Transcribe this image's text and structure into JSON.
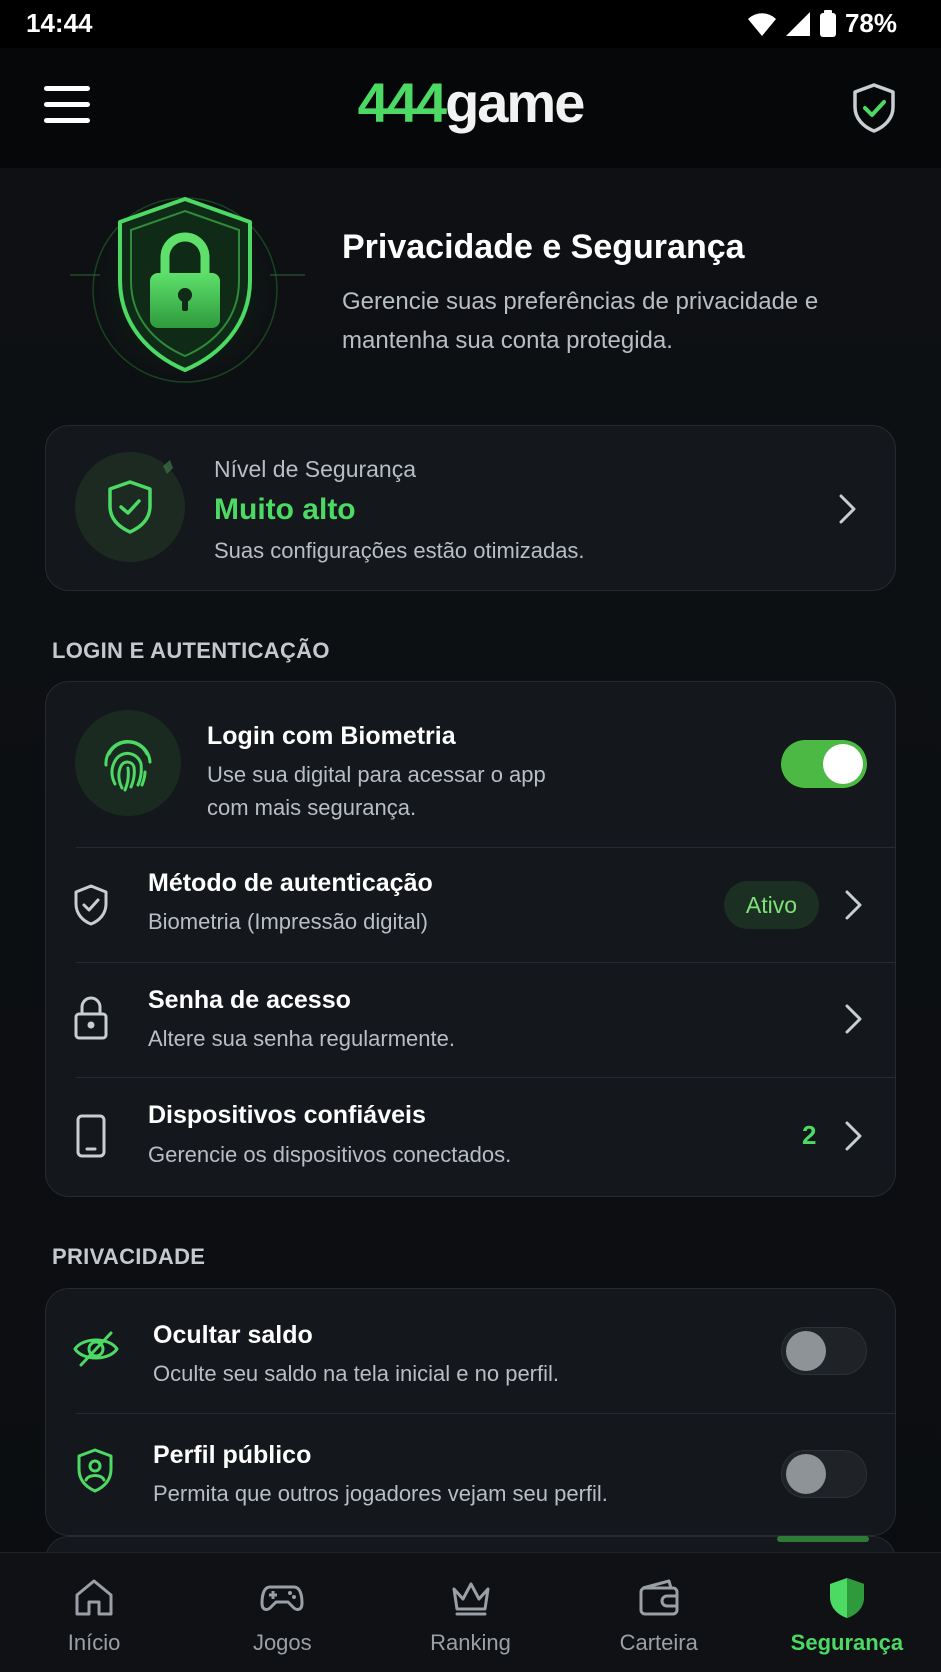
{
  "status_bar": {
    "time": "14:44",
    "battery": "78%"
  },
  "app_bar": {
    "logo_number": "444",
    "logo_word": "game"
  },
  "hero": {
    "title": "Privacidade e Segurança",
    "subtitle": "Gerencie suas preferências de privacidade e mantenha sua conta protegida."
  },
  "security_level": {
    "label": "Nível de Segurança",
    "value": "Muito alto",
    "description": "Suas configurações estão otimizadas."
  },
  "login_section": {
    "title": "LOGIN E AUTENTICAÇÃO",
    "biometric": {
      "title": "Login com Biometria",
      "subtitle_line1": "Use sua digital para acessar o app",
      "subtitle_line2": "com mais segurança.",
      "enabled": true
    },
    "auth_method": {
      "title": "Método de autenticação",
      "subtitle": "Biometria (Impressão digital)",
      "badge": "Ativo"
    },
    "password": {
      "title": "Senha de acesso",
      "subtitle": "Altere sua senha regularmente."
    },
    "devices": {
      "title": "Dispositivos confiáveis",
      "subtitle": "Gerencie os dispositivos conectados.",
      "count": "2"
    }
  },
  "privacy_section": {
    "title": "PRIVACIDADE",
    "hide_balance": {
      "title": "Ocultar saldo",
      "subtitle": "Oculte seu saldo na tela inicial e no perfil.",
      "enabled": false
    },
    "public_profile": {
      "title": "Perfil público",
      "subtitle": "Permita que outros jogadores vejam seu perfil.",
      "enabled": false
    }
  },
  "bottom_nav": {
    "items": [
      {
        "label": "Início",
        "icon": "home-icon"
      },
      {
        "label": "Jogos",
        "icon": "gamepad-icon"
      },
      {
        "label": "Ranking",
        "icon": "crown-icon"
      },
      {
        "label": "Carteira",
        "icon": "wallet-icon"
      },
      {
        "label": "Segurança",
        "icon": "shield-icon",
        "active": true
      }
    ]
  },
  "colors": {
    "accent": "#4cd964",
    "background": "#0b0d10",
    "card": "#14171b",
    "muted_text": "#b9bec4"
  }
}
